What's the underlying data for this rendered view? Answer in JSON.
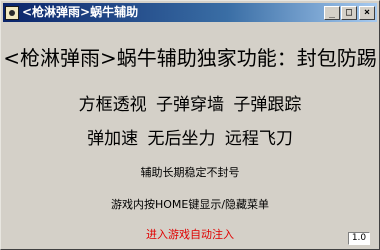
{
  "window": {
    "title": "<枪淋弹雨>蜗牛辅助",
    "icon": "app-icon",
    "buttons": {
      "minimize": "_",
      "maximize": "□",
      "close": "×"
    }
  },
  "content": {
    "headline": "<枪淋弹雨>蜗牛辅助独家功能：封包防踢",
    "features_line1": "方框透视 子弹穿墙 子弹跟踪",
    "features_line2": "弹加速 无后坐力 远程飞刀",
    "note_stable": "辅助长期稳定不封号",
    "note_home_key": "游戏内按HOME键显示/隐藏菜单",
    "status_text": "进入游戏自动注入",
    "version": "1.0"
  },
  "colors": {
    "title_bar_start": "#0a246a",
    "title_bar_end": "#a6caf0",
    "window_bg": "#d4d0c8",
    "status_text": "#e00000"
  }
}
